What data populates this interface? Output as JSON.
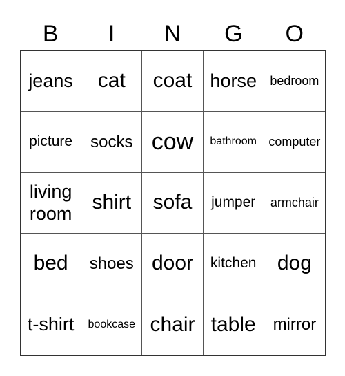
{
  "header": {
    "letters": [
      "B",
      "I",
      "N",
      "G",
      "O"
    ]
  },
  "grid": {
    "rows": [
      [
        "jeans",
        "cat",
        "coat",
        "horse",
        "bedroom"
      ],
      [
        "picture",
        "socks",
        "cow",
        "bathroom",
        "computer"
      ],
      [
        "living room",
        "shirt",
        "sofa",
        "jumper",
        "armchair"
      ],
      [
        "bed",
        "shoes",
        "door",
        "kitchen",
        "dog"
      ],
      [
        "t-shirt",
        "bookcase",
        "chair",
        "table",
        "mirror"
      ]
    ]
  }
}
